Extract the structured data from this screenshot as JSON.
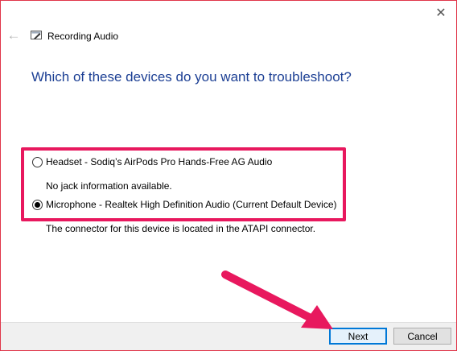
{
  "window": {
    "title": "Recording Audio",
    "close_icon": "close-icon",
    "back_icon": "back-arrow-icon",
    "title_icon": "troubleshooter-icon"
  },
  "heading": "Which of these devices do you want to troubleshoot?",
  "devices": [
    {
      "label": "Headset - Sodiq’s AirPods Pro Hands-Free AG Audio",
      "description": "No jack information available.",
      "selected": false
    },
    {
      "label": "Microphone - Realtek High Definition Audio (Current Default Device)",
      "description": "The connector for this device is located in the ATAPI connector.",
      "selected": true
    }
  ],
  "buttons": {
    "next": "Next",
    "cancel": "Cancel"
  },
  "annotation": {
    "color": "#e8185e"
  }
}
